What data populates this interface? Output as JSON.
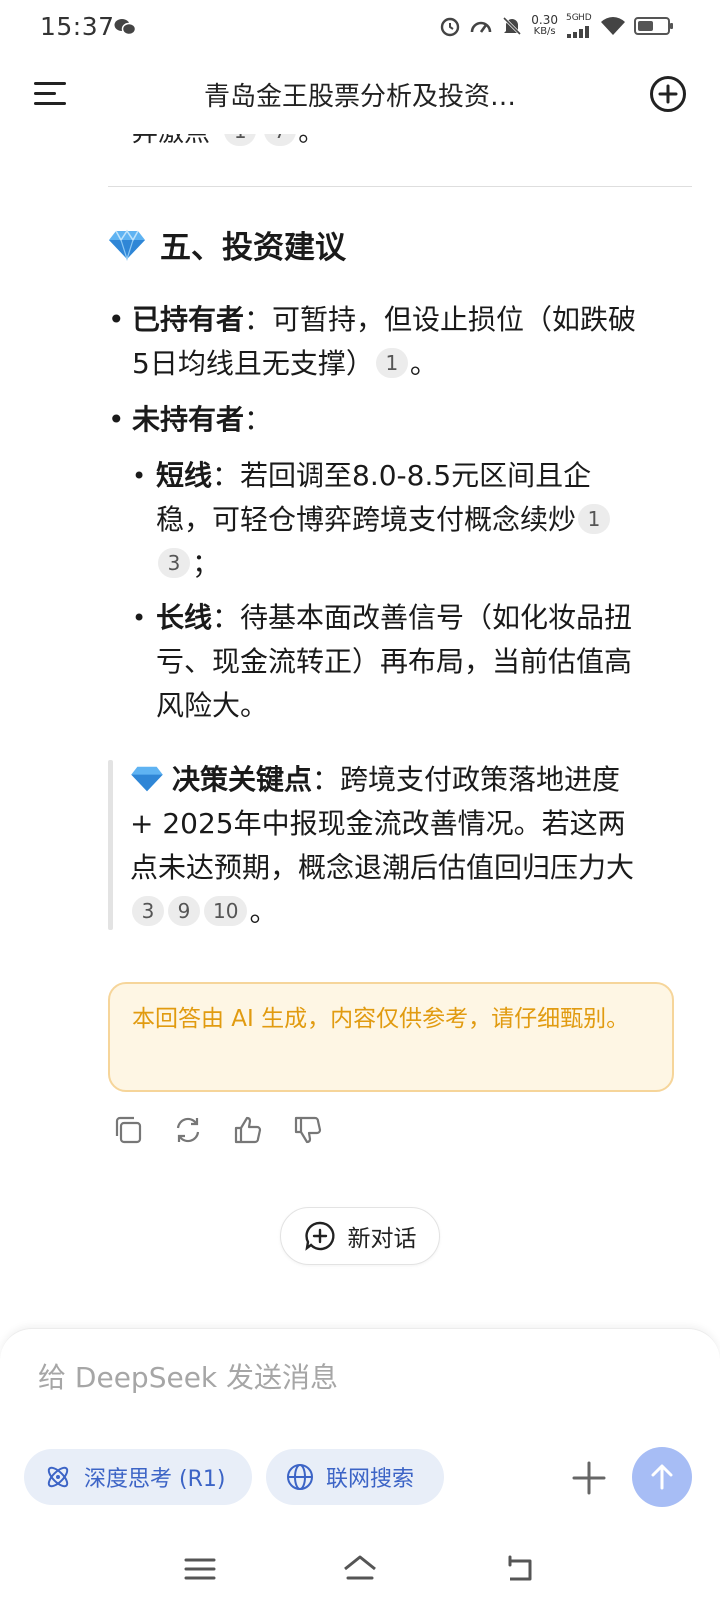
{
  "status_bar": {
    "time": "15:37",
    "net_speed_value": "0.30",
    "net_speed_unit": "KB/s",
    "network_label_1": "5G",
    "network_label_2": "HD",
    "battery_level": 0.55,
    "icons": [
      "wechat-icon",
      "alarm-icon",
      "speedometer-icon",
      "mute-bell-icon",
      "signal-icon",
      "wifi-icon",
      "battery-icon"
    ]
  },
  "header": {
    "title": "青岛金王股票分析及投资…",
    "menu_icon": "menu-icon",
    "new_chat_icon": "plus-circle-icon"
  },
  "content": {
    "cut_off_text": "弃",
    "cut_off_text_rest": "激点",
    "cut_off_cites": [
      "1",
      "7"
    ],
    "cut_off_end": "。",
    "section_heading": "五、投资建议",
    "section_icon": "gem-icon",
    "bullet1_bold": "已持有者",
    "bullet1_text_a": "：可暂持，但设止损位（如跌破",
    "bullet1_text_b": "5日均线且无支撑）",
    "bullet1_cite": "1",
    "bullet1_end": "。",
    "bullet2_bold": "未持有者",
    "bullet2_text": "：",
    "sub1_bold": "短线",
    "sub1_text_a": "：若回调至8.0-8.5元区间且企",
    "sub1_text_b": "稳，可轻仓博弈跨境支付概念续炒",
    "sub1_cite_1": "1",
    "sub1_cite_2": "3",
    "sub1_end": "；",
    "sub2_bold": "长线",
    "sub2_text_a": "：待基本面改善信号（如化妆品扭",
    "sub2_text_b": "亏、现金流转正）再布局，当前估值高",
    "sub2_text_c": "风险大。",
    "quote_bold": "决策关键点",
    "quote_text_a": "：跨境支付政策落地进度",
    "quote_text_b": "+ 2025年中报现金流改善情况。若这两",
    "quote_text_c": "点未达预期，概念退潮后估值回归压力大",
    "quote_cites": [
      "3",
      "9",
      "10"
    ],
    "quote_end": "。",
    "notice": "本回答由 AI 生成，内容仅供参考，请仔细甄别。"
  },
  "actions": {
    "icons": [
      "copy-icon",
      "regenerate-icon",
      "thumbs-up-icon",
      "thumbs-down-icon"
    ]
  },
  "new_dialog_label": "新对话",
  "composer": {
    "placeholder": "给 DeepSeek 发送消息",
    "deep_think_label": "深度思考 (R1)",
    "web_search_label": "联网搜索"
  },
  "colors": {
    "accent": "#3c64c6",
    "send_button": "#a7bdf5",
    "notice_text": "#e19b10",
    "notice_bg": "#fef6e4",
    "gem": "#3a8fe0"
  }
}
